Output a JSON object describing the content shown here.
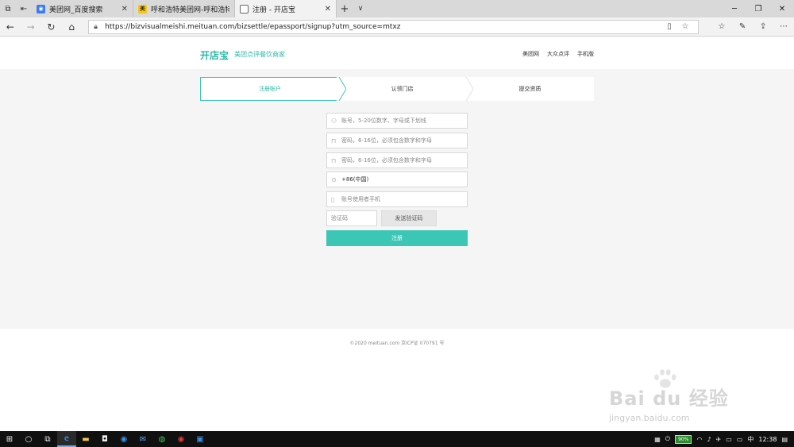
{
  "browser": {
    "tabs": [
      {
        "title": "美团网_百度搜索",
        "fav_color": "#3b7cf0",
        "fav_glyph": "◉"
      },
      {
        "title": "呼和浩特美团网-呼和浩特美",
        "fav_color": "#f5c518",
        "fav_glyph": "美"
      },
      {
        "title": "注册 - 开店宝",
        "fav_color": "#ffffff",
        "fav_glyph": "▭"
      }
    ],
    "url": "https://bizvisualmeishi.meituan.com/bizsettle/epassport/signup?utm_source=mtxz",
    "url_domain": "bizvisualmeishi.meituan.com"
  },
  "site": {
    "logo": "开店宝",
    "logo_sub": "美团点评餐饮商家",
    "links": [
      "美团网",
      "大众点评",
      "手机版"
    ]
  },
  "steps": [
    "注册账户",
    "认领门店",
    "提交资质"
  ],
  "form": {
    "account_placeholder": "账号，5-20位数字、字母或下划线",
    "password_placeholder": "密码，6-16位，必须包含数字和字母",
    "password_confirm_placeholder": "密码，6-16位，必须包含数字和字母",
    "country_code": "+86(中国)",
    "phone_placeholder": "账号使用者手机",
    "vcode_placeholder": "验证码",
    "send_code": "发送验证码",
    "submit": "注册"
  },
  "footer": {
    "copyright": "©2020 meituan.com 京ICP证 070791 号"
  },
  "watermark": {
    "brand": "Bai du 经验",
    "sub": "jingyan.baidu.com"
  },
  "taskbar": {
    "battery": "90%",
    "time": "12:38"
  },
  "colors": {
    "brand": "#2bb8a7",
    "button": "#3cc6b5"
  }
}
